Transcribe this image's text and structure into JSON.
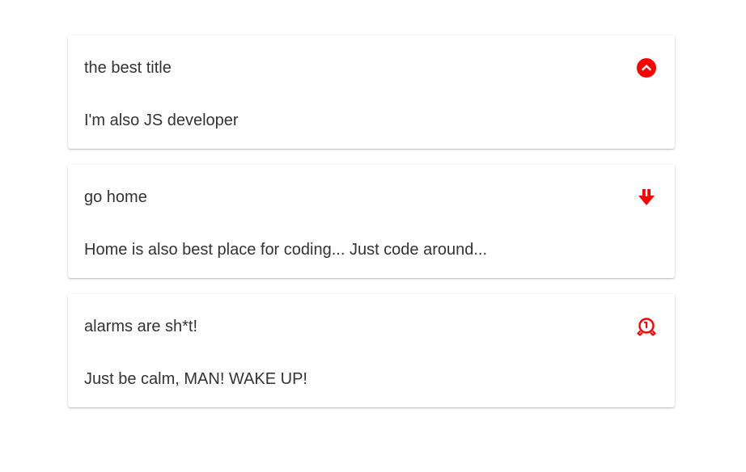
{
  "colors": {
    "icon": "#ff0000",
    "text": "#333333",
    "card_background": "#ffffff"
  },
  "notes": [
    {
      "title": "the best title",
      "body": "I'm also JS developer",
      "icon": "chevron-up-circle-icon"
    },
    {
      "title": "go home",
      "body": "Home is also best place for coding... Just code around...",
      "icon": "arrow-down-bold-icon"
    },
    {
      "title": "alarms are sh*t!",
      "body": "Just be calm, MAN! WAKE UP!",
      "icon": "alarm-icon"
    }
  ]
}
